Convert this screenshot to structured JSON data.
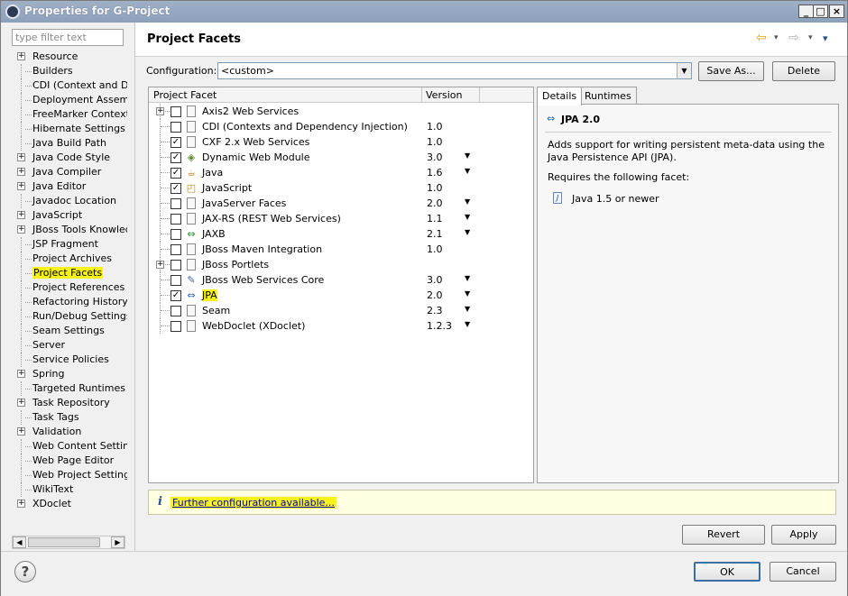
{
  "window": {
    "title": "Properties for G-Project",
    "minimize": "_",
    "maximize": "□",
    "close": "×"
  },
  "filter": {
    "placeholder": "type filter text"
  },
  "nav": {
    "items": [
      {
        "label": "Resource",
        "expandable": true
      },
      {
        "label": "Builders",
        "expandable": false
      },
      {
        "label": "CDI (Context and Dependency Injection)",
        "expandable": false
      },
      {
        "label": "Deployment Assembly",
        "expandable": false
      },
      {
        "label": "FreeMarker Context",
        "expandable": false
      },
      {
        "label": "Hibernate Settings",
        "expandable": false
      },
      {
        "label": "Java Build Path",
        "expandable": false
      },
      {
        "label": "Java Code Style",
        "expandable": true
      },
      {
        "label": "Java Compiler",
        "expandable": true
      },
      {
        "label": "Java Editor",
        "expandable": true
      },
      {
        "label": "Javadoc Location",
        "expandable": false
      },
      {
        "label": "JavaScript",
        "expandable": true
      },
      {
        "label": "JBoss Tools Knowledge Base",
        "expandable": true
      },
      {
        "label": "JSP Fragment",
        "expandable": false
      },
      {
        "label": "Project Archives",
        "expandable": false
      },
      {
        "label": "Project Facets",
        "expandable": false,
        "selected": true
      },
      {
        "label": "Project References",
        "expandable": false
      },
      {
        "label": "Refactoring History",
        "expandable": false
      },
      {
        "label": "Run/Debug Settings",
        "expandable": false
      },
      {
        "label": "Seam Settings",
        "expandable": false
      },
      {
        "label": "Server",
        "expandable": false
      },
      {
        "label": "Service Policies",
        "expandable": false
      },
      {
        "label": "Spring",
        "expandable": true
      },
      {
        "label": "Targeted Runtimes",
        "expandable": false
      },
      {
        "label": "Task Repository",
        "expandable": true
      },
      {
        "label": "Task Tags",
        "expandable": false
      },
      {
        "label": "Validation",
        "expandable": true
      },
      {
        "label": "Web Content Settings",
        "expandable": false
      },
      {
        "label": "Web Page Editor",
        "expandable": false
      },
      {
        "label": "Web Project Settings",
        "expandable": false
      },
      {
        "label": "WikiText",
        "expandable": false
      },
      {
        "label": "XDoclet",
        "expandable": true
      }
    ],
    "scroll_left": "◀",
    "scroll_right": "▶"
  },
  "page": {
    "title": "Project Facets",
    "back": "⇦",
    "forward": "⇨",
    "menu_glyph": "▾",
    "config_label": "Configuration:",
    "config_value": "<custom>",
    "dropdown_glyph": "▼",
    "save_as": "Save As...",
    "delete": "Delete"
  },
  "facets": {
    "columns": [
      "Project Facet",
      "Version"
    ],
    "rows": [
      {
        "name": "Axis2 Web Services",
        "version": "",
        "checked": false,
        "expandable": true,
        "dropdown": false,
        "icon": "doc-icon"
      },
      {
        "name": "CDI (Contexts and Dependency Injection)",
        "version": "1.0",
        "checked": false,
        "expandable": false,
        "dropdown": false,
        "icon": "doc-icon"
      },
      {
        "name": "CXF 2.x Web Services",
        "version": "1.0",
        "checked": true,
        "expandable": false,
        "dropdown": false,
        "icon": "doc-icon"
      },
      {
        "name": "Dynamic Web Module",
        "version": "3.0",
        "checked": true,
        "expandable": false,
        "dropdown": true,
        "icon": "web-module-icon"
      },
      {
        "name": "Java",
        "version": "1.6",
        "checked": true,
        "expandable": false,
        "dropdown": true,
        "icon": "java-icon"
      },
      {
        "name": "JavaScript",
        "version": "1.0",
        "checked": true,
        "expandable": false,
        "dropdown": false,
        "icon": "javascript-icon"
      },
      {
        "name": "JavaServer Faces",
        "version": "2.0",
        "checked": false,
        "expandable": false,
        "dropdown": true,
        "icon": "doc-icon"
      },
      {
        "name": "JAX-RS (REST Web Services)",
        "version": "1.1",
        "checked": false,
        "expandable": false,
        "dropdown": true,
        "icon": "doc-icon"
      },
      {
        "name": "JAXB",
        "version": "2.1",
        "checked": false,
        "expandable": false,
        "dropdown": true,
        "icon": "jaxb-icon"
      },
      {
        "name": "JBoss Maven Integration",
        "version": "1.0",
        "checked": false,
        "expandable": false,
        "dropdown": false,
        "icon": "doc-icon"
      },
      {
        "name": "JBoss Portlets",
        "version": "",
        "checked": false,
        "expandable": true,
        "dropdown": false,
        "icon": "doc-icon"
      },
      {
        "name": "JBoss Web Services Core",
        "version": "3.0",
        "checked": false,
        "expandable": false,
        "dropdown": true,
        "icon": "webservices-icon"
      },
      {
        "name": "JPA",
        "version": "2.0",
        "checked": true,
        "expandable": false,
        "dropdown": true,
        "icon": "jpa-icon",
        "highlight": true
      },
      {
        "name": "Seam",
        "version": "2.3",
        "checked": false,
        "expandable": false,
        "dropdown": true,
        "icon": "doc-icon"
      },
      {
        "name": "WebDoclet (XDoclet)",
        "version": "1.2.3",
        "checked": false,
        "expandable": false,
        "dropdown": true,
        "icon": "doc-icon"
      }
    ],
    "checkmark": "✓",
    "dropdown_glyph": "▼",
    "expand_glyph": "+"
  },
  "details": {
    "tabs": [
      "Details",
      "Runtimes"
    ],
    "title": "JPA 2.0",
    "description": "Adds support for writing persistent meta-data using the Java Persistence API (JPA).",
    "requires_label": "Requires the following facet:",
    "required_item": "Java 1.5 or newer",
    "required_icon_glyph": "J"
  },
  "info": {
    "icon": "i",
    "link": "Further configuration available..."
  },
  "actions": {
    "revert": "Revert",
    "apply": "Apply",
    "ok": "OK",
    "cancel": "Cancel",
    "help": "?"
  },
  "colors": {
    "highlight": "#f6f21a",
    "info_bg": "#ffffe1",
    "link": "#0000cc"
  }
}
